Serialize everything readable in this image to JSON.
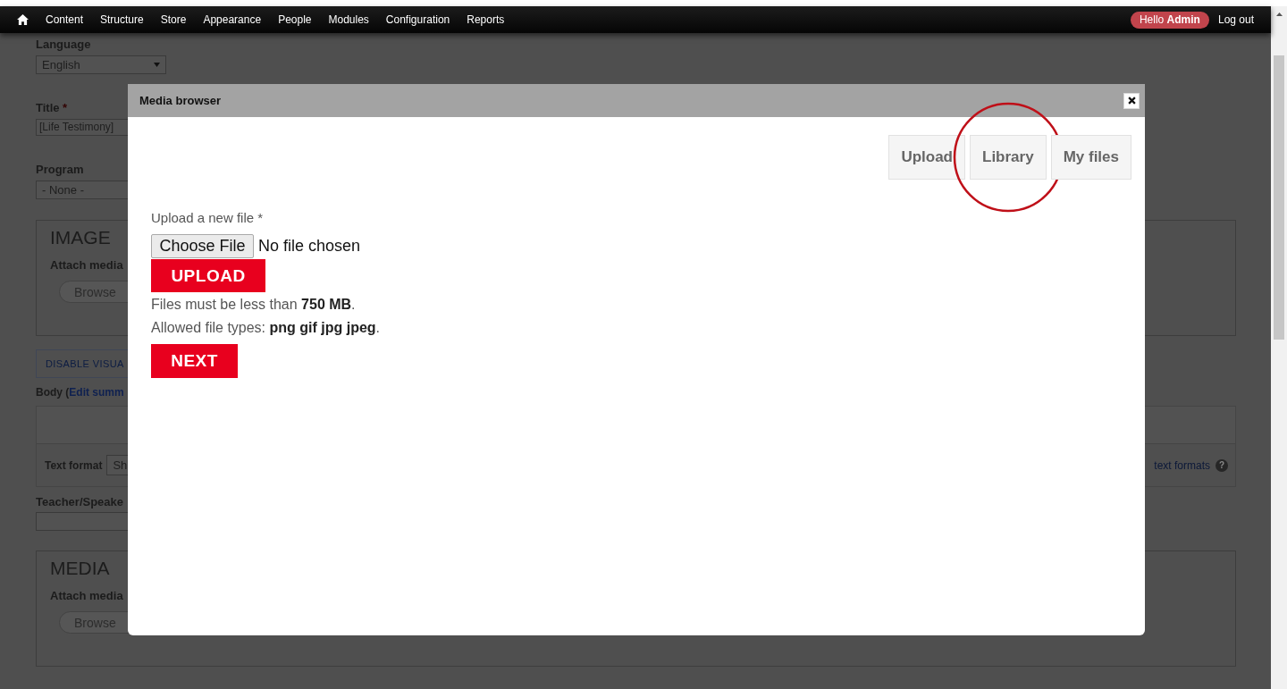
{
  "toolbar": {
    "items": [
      "Content",
      "Structure",
      "Store",
      "Appearance",
      "People",
      "Modules",
      "Configuration",
      "Reports"
    ],
    "greeting": "Hello **Admin**",
    "logout": "Log out"
  },
  "form": {
    "language": {
      "label": "Language",
      "value": "English"
    },
    "title": {
      "label": "Title",
      "required_mark": "*",
      "value": "[Life Testimony]"
    },
    "program": {
      "label": "Program",
      "value": "- None -"
    },
    "image_section": {
      "heading": "IMAGE",
      "label": "Attach media",
      "button": "Browse"
    },
    "editor_toggle": "DISABLE VISUA",
    "body": {
      "label": "Body (",
      "link": "Edit summ"
    },
    "text_format": {
      "label": "Text format",
      "value": "Sh",
      "help_link": "text formats",
      "help_icon": "?"
    },
    "teacher": {
      "label": "Teacher/Speake"
    },
    "media_section": {
      "heading": "MEDIA",
      "label": "Attach media",
      "button": "Browse"
    }
  },
  "modal": {
    "title": "Media browser",
    "tabs": [
      {
        "label": "Upload",
        "circled": false
      },
      {
        "label": "Library",
        "circled": true
      },
      {
        "label": "My files",
        "circled": false
      }
    ],
    "upload": {
      "label": "Upload a new file *",
      "file_button": "Choose File",
      "file_status": "No file chosen",
      "upload_button": "UPLOAD",
      "size_note": "Files must be less than **750 MB**.",
      "types_note": "Allowed file types: **png gif jpg jpeg**.",
      "next_button": "NEXT"
    }
  }
}
